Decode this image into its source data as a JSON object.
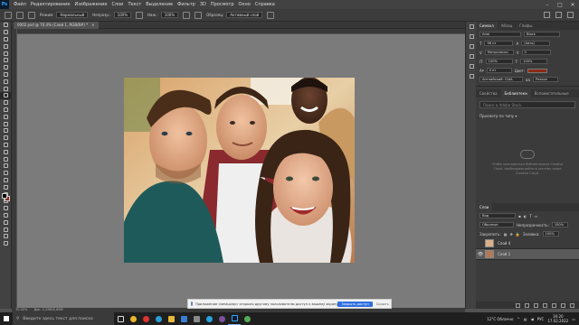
{
  "menubar": {
    "logo": "Ps",
    "items": [
      "Файл",
      "Редактирование",
      "Изображение",
      "Слои",
      "Текст",
      "Выделение",
      "Фильтр",
      "3D",
      "Просмотр",
      "Окно",
      "Справка"
    ]
  },
  "optbar": {
    "mode_label": "Режим:",
    "mode_value": "Нормальный",
    "opacity_label": "Непрозр.:",
    "opacity_value": "100%",
    "flow_label": "Наж.:",
    "flow_value": "100%",
    "sample_label": "Образец:",
    "sample_value": "Активный слой"
  },
  "document": {
    "tab_title": "0002.psd @ 70.4% (Слой 1, RGB/8#) *",
    "tab_close": "×"
  },
  "status": {
    "zoom": "70.42%",
    "doc_info": "Док: 2,29М/5,69М"
  },
  "notification": {
    "text": "Приложение «bestuplay» открыло другому пользователю доступ к вашему экрану",
    "action_label": "Закрыть доступ",
    "hide_label": "Скрыть"
  },
  "panels": {
    "top_tabs": [
      "Символ",
      "Абзац",
      "Глифы"
    ],
    "font_family": "Arial",
    "font_style": "Black",
    "font_size": "96 пт",
    "leading": "(Авто)",
    "kerning": "Метрически",
    "tracking": "0",
    "vscale": "100%",
    "hscale": "100%",
    "baseline": "0 пт",
    "color_label": "Цвет:",
    "lang": "Английский: США",
    "aa": "Резкое",
    "mid_tabs": [
      "Свойства",
      "Библиотеки",
      "Вспомогательные"
    ],
    "lib_search_placeholder": "Поиск в Adobe Stock",
    "lib_view": "Просмотр по типу ▾",
    "lib_empty_text": "Чтобы пользоваться библиотеками Creative Cloud, необходимо войти в систему через Creative Cloud.",
    "layers_tab": "Слои",
    "layers_kind": "Вид",
    "layers_mode": "Обычные",
    "layers_opacity_label": "Непрозрачность:",
    "layers_opacity": "100%",
    "lock_label": "Закрепить:",
    "fill_label": "Заливка:",
    "fill": "100%",
    "layers": [
      {
        "name": "Слой 4",
        "selected": false
      },
      {
        "name": "Слой 1",
        "selected": true
      }
    ]
  },
  "taskbar": {
    "search_placeholder": "Введите здесь текст для поиска",
    "temperature": "12°C Облачно",
    "lang": "РУС",
    "time": "16:20",
    "date": "17.02.2022"
  }
}
